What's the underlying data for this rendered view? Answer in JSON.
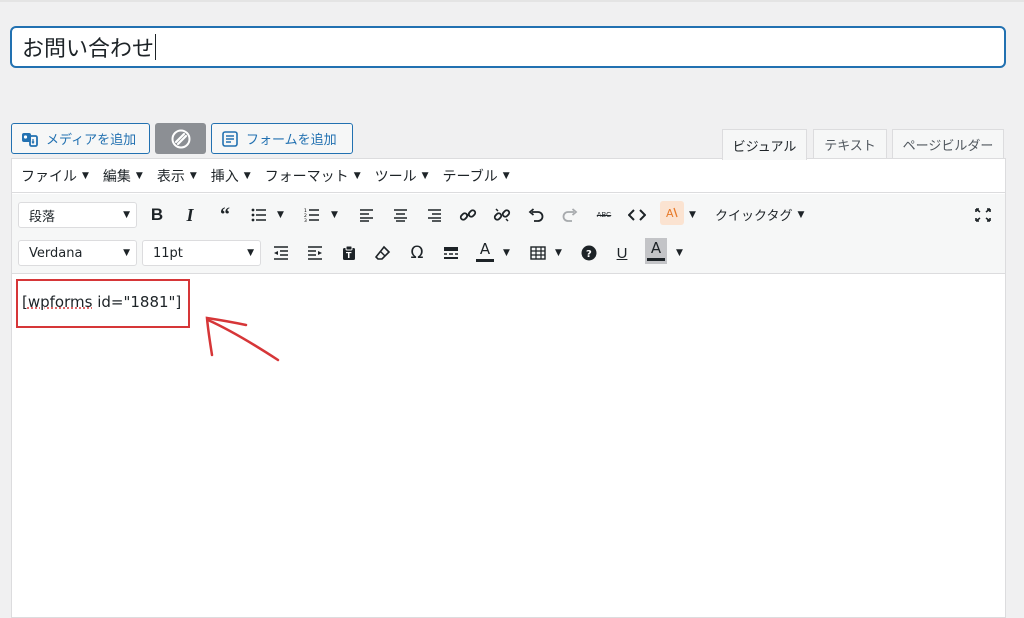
{
  "title_input": {
    "value": "お問い合わせ"
  },
  "media_buttons": {
    "add_media": "メディアを追加",
    "add_form": "フォームを追加"
  },
  "tabs": [
    {
      "label": "ビジュアル",
      "active": true
    },
    {
      "label": "テキスト",
      "active": false
    },
    {
      "label": "ページビルダー",
      "active": false
    }
  ],
  "menubar": [
    "ファイル",
    "編集",
    "表示",
    "挿入",
    "フォーマット",
    "ツール",
    "テーブル"
  ],
  "toolbar1": {
    "format_select": "段落",
    "quick_tags": "クイックタグ"
  },
  "toolbar2": {
    "font_select": "Verdana",
    "size_select": "11pt"
  },
  "content": {
    "shortcode_prefix": "[",
    "shortcode_word": "wpforms",
    "shortcode_rest": " id=\"1881\"]"
  },
  "colors": {
    "accent": "#2271b1",
    "annotation": "#d63638"
  }
}
